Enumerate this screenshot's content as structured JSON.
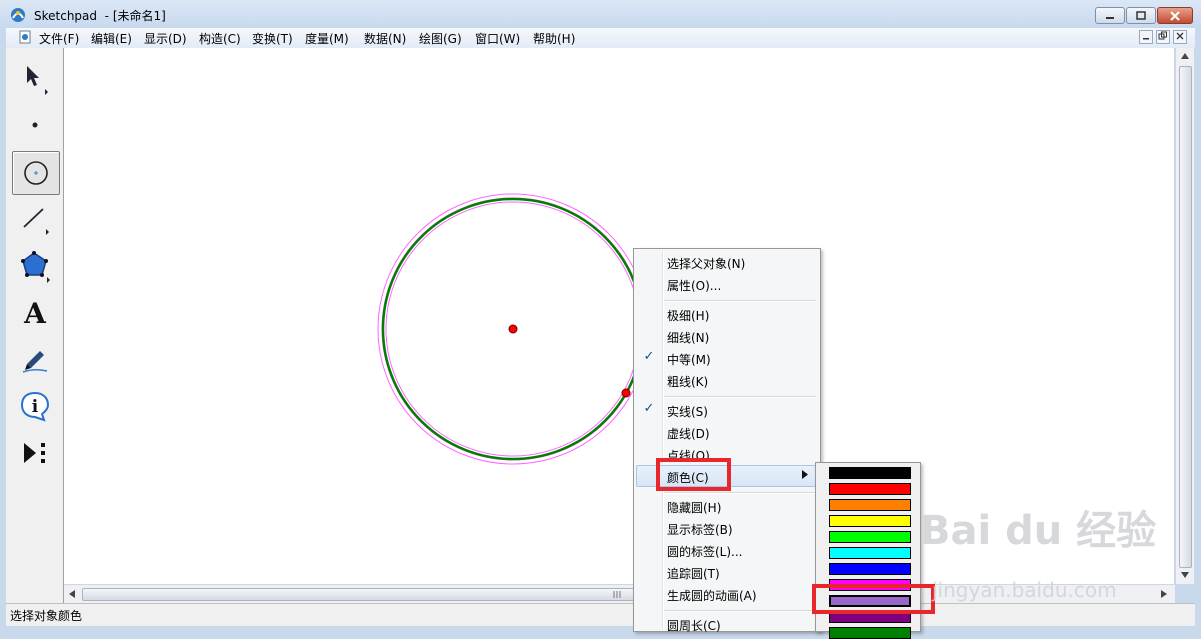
{
  "window": {
    "app_name": "Sketchpad",
    "document": "- [未命名1]"
  },
  "menubar": {
    "items": [
      "文件(F)",
      "编辑(E)",
      "显示(D)",
      "构造(C)",
      "变换(T)",
      "度量(M)",
      "数据(N)",
      "绘图(G)",
      "窗口(W)",
      "帮助(H)"
    ]
  },
  "toolbox": {
    "tools": [
      "arrow-tool",
      "point-tool",
      "compass-tool",
      "line-tool",
      "polygon-tool",
      "text-tool",
      "marker-tool",
      "information-tool",
      "custom-tool"
    ],
    "text_tool_glyph": "A",
    "active_tool": "compass-tool"
  },
  "context_menu": {
    "items": {
      "select_parents": "选择父对象(N)",
      "properties": "属性(O)...",
      "thinnest": "极细(H)",
      "thin": "细线(N)",
      "medium": "中等(M)",
      "thick": "粗线(K)",
      "solid": "实线(S)",
      "dashed": "虚线(D)",
      "dotted": "点线(O)",
      "color": "颜色(C)",
      "hide": "隐藏圆(H)",
      "show_label": "显示标签(B)",
      "circle_label": "圆的标签(L)...",
      "trace": "追踪圆(T)",
      "animate": "生成圆的动画(A)",
      "circumference": "圆周长(C)"
    },
    "checked": [
      "medium",
      "solid"
    ],
    "highlighted": "color"
  },
  "palette": {
    "colors": [
      "#000000",
      "#ff0000",
      "#ff8000",
      "#ffff00",
      "#00ff00",
      "#00ffff",
      "#0000ff",
      "#ff00ff",
      "#9966cc",
      "#800080",
      "#008000"
    ],
    "selected_index": 8
  },
  "statusbar": {
    "text": "选择对象颜色"
  },
  "watermark": {
    "brand": "Bai du 经验",
    "url": "jingyan.baidu.com"
  },
  "colors": {
    "circle_stroke": "#008000",
    "selection_halo": "#ff66ff",
    "point_fill": "#ff0000",
    "highlight_box": "#e8262b"
  }
}
